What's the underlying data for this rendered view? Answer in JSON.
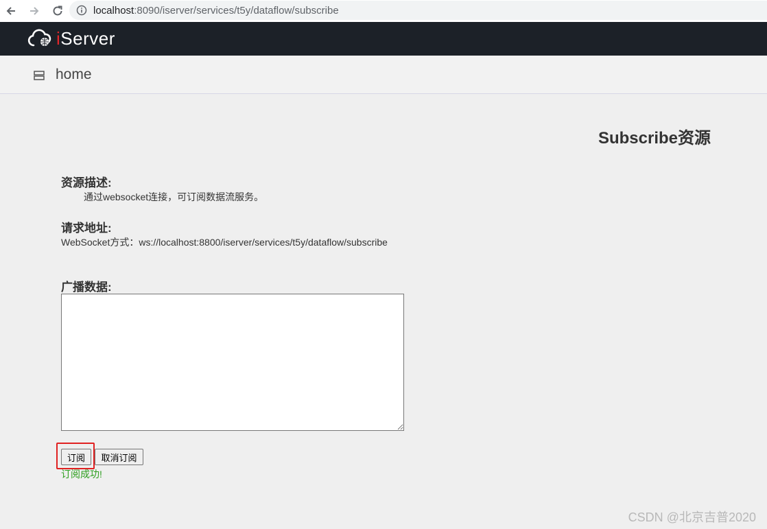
{
  "browser": {
    "url_host": "localhost",
    "url_rest": ":8090/iserver/services/t5y/dataflow/subscribe"
  },
  "app": {
    "brand_i": "i",
    "brand_rest": "Server"
  },
  "breadcrumb": {
    "label": "home"
  },
  "page": {
    "title": "Subscribe资源",
    "desc_label": "资源描述:",
    "desc_text": "通过websocket连接，可订阅数据流服务。",
    "addr_label": "请求地址:",
    "ws_url": "WebSocket方式：ws://localhost:8800/iserver/services/t5y/dataflow/subscribe",
    "broadcast_label": "广播数据:",
    "broadcast_value": ""
  },
  "actions": {
    "subscribe_label": "订阅",
    "unsubscribe_label": "取消订阅",
    "status_text": "订阅成功!"
  },
  "watermark": "CSDN @北京吉普2020",
  "colors": {
    "header_bg": "#1c2128",
    "brand_accent": "#e0262b",
    "success": "#2e9e1f",
    "highlight": "#e02020"
  }
}
